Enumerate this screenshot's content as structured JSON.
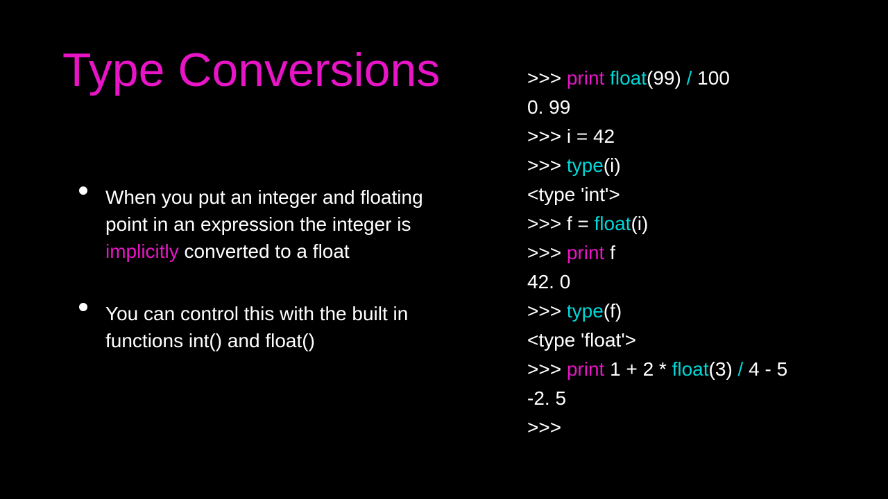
{
  "title": "Type Conversions",
  "bullets": [
    {
      "pre": "When you put an integer and floating point in an expression the integer is ",
      "em": "implicitly",
      "post": " converted to a float"
    },
    {
      "pre": "You can control this with the built in functions int() and float()",
      "em": "",
      "post": ""
    }
  ],
  "code": {
    "l0_prompt": ">>> ",
    "l0_print": "print ",
    "l0_float": "float",
    "l0_p99": "(99) ",
    "l0_slash": "/",
    "l0_100": " 100",
    "l1": "0. 99",
    "l2": ">>> i = 42",
    "l3_prompt": ">>> ",
    "l3_type": "type",
    "l3_i": "(i)",
    "l4": "<type 'int'>",
    "l5_prompt": ">>> f = ",
    "l5_float": "float",
    "l5_i": "(i)",
    "l6_prompt": ">>> ",
    "l6_print": "print",
    "l6_f": " f",
    "l7": "42. 0",
    "l8_prompt": ">>> ",
    "l8_type": "type",
    "l8_f": "(f)",
    "l9": "<type 'float'>",
    "l10_prompt": ">>> ",
    "l10_print": "print",
    "l10_mid": " 1 + 2 * ",
    "l10_float": "float",
    "l10_p3": "(3) ",
    "l10_slash": "/",
    "l10_rest": " 4 - 5",
    "l11": "-2. 5",
    "l12": ">>>"
  }
}
